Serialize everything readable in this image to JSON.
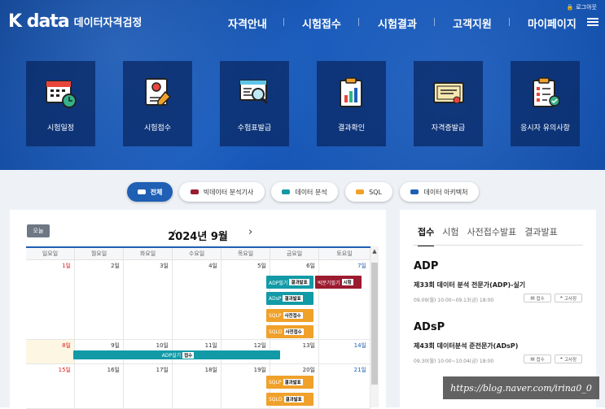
{
  "header": {
    "logo_mark": "K data",
    "logo_sub": "데이터자격검정",
    "logout": "로그아웃",
    "nav": [
      "자격안내",
      "시험접수",
      "시험결과",
      "고객지원",
      "마이페이지"
    ]
  },
  "tiles": [
    "시험일정",
    "시험접수",
    "수험표발급",
    "결과확인",
    "자격증발급",
    "응시자 유의사항"
  ],
  "filters": [
    {
      "label": "전체",
      "color": "#ffffff"
    },
    {
      "label": "빅데이터 분석기사",
      "color": "#9b1b2f"
    },
    {
      "label": "데이터 분석",
      "color": "#129aa6"
    },
    {
      "label": "SQL",
      "color": "#f0a12a"
    },
    {
      "label": "데이터 아키텍처",
      "color": "#1f5fb4"
    }
  ],
  "calendar": {
    "today": "오늘",
    "month": "2024년 9월",
    "prev": "‹",
    "next": "›",
    "days": [
      "일요일",
      "월요일",
      "화요일",
      "수요일",
      "목요일",
      "금요일",
      "토요일"
    ],
    "week1": [
      "1일",
      "2일",
      "3일",
      "4일",
      "5일",
      "6일",
      "7일"
    ],
    "week2": [
      "8일",
      "9일",
      "10일",
      "11일",
      "12일",
      "13일",
      "14일"
    ],
    "week3": [
      "15일",
      "16일",
      "17일",
      "18일",
      "19일",
      "20일",
      "21일"
    ],
    "events": {
      "e1": {
        "name": "ADP필기",
        "tag": "결과발표"
      },
      "e2": {
        "name": "ADsP",
        "tag": "결과발표"
      },
      "e3": {
        "name": "SQLP",
        "tag": "사전접수"
      },
      "e4": {
        "name": "SQLD",
        "tag": "사전접수"
      },
      "e5": {
        "name": "빅분기필기",
        "tag": "시험"
      },
      "e6": {
        "name": "ADP실기",
        "tag": "접수"
      },
      "e7": {
        "name": "SQLP",
        "tag": "결과발표"
      },
      "e8": {
        "name": "SQLD",
        "tag": "결과발표"
      }
    }
  },
  "side": {
    "tabs": [
      "접수",
      "시험",
      "사전접수발표",
      "결과발표"
    ],
    "items": [
      {
        "cert": "ADP",
        "title": "제33회 데이터 분석 전문가(ADP)-실기",
        "date": "09.09(월) 10:00~09.13(금) 18:00",
        "b1": "접수",
        "b2": "고사장"
      },
      {
        "cert": "ADsP",
        "title": "제43회 데이터분석 준전문가(ADsP)",
        "date": "09.30(월) 10:00~10.04(금) 18:00",
        "b1": "접수",
        "b2": "고사장"
      }
    ]
  },
  "watermark": "https://blog.naver.com/irina0_0"
}
